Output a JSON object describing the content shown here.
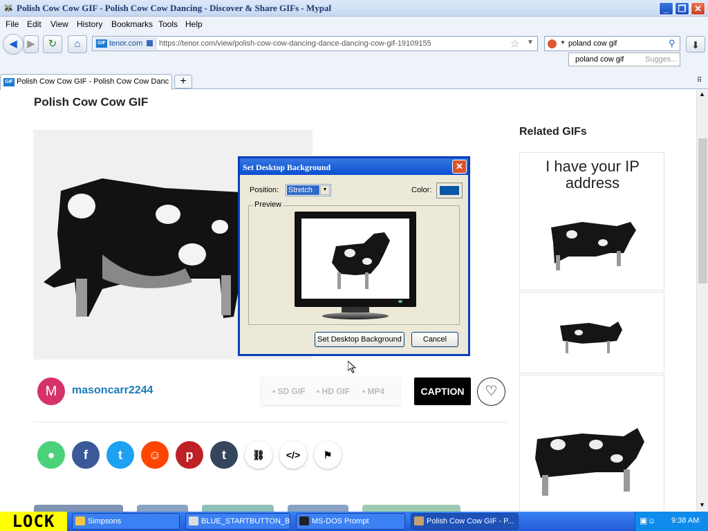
{
  "window": {
    "title": "Polish Cow Cow GIF - Polish Cow Cow Dancing - Discover & Share GIFs - Mypal",
    "minimize": "_",
    "restore": "❐",
    "close": "✕"
  },
  "menu": [
    "File",
    "Edit",
    "View",
    "History",
    "Bookmarks",
    "Tools",
    "Help"
  ],
  "nav": {
    "site_label": "tenor.com",
    "site_icon": "GIF",
    "url": "https://tenor.com/view/polish-cow-cow-dancing-dance-dancing-cow-gif-19109155",
    "search_value": "poland cow gif",
    "suggestion": "poland cow gif",
    "suggestion_hint": "Sugges..."
  },
  "tabs": {
    "active_label": "Polish Cow Cow GIF - Polish Cow Cow Danci...",
    "favicon": "GIF",
    "new_tab": "+"
  },
  "page": {
    "title": "Polish Cow Cow GIF",
    "related_title": "Related GIFs",
    "related_caption": "I have your IP address",
    "user_initial": "M",
    "username": "masoncarr2244",
    "formats": [
      "• SD GIF",
      "• HD GIF",
      "• MP4"
    ],
    "caption_button": "CAPTION",
    "share_colors": [
      "#4bd17a",
      "#3b5998",
      "#1da1f2",
      "#ff4500",
      "#bd2125",
      "#35465c"
    ]
  },
  "dialog": {
    "title": "Set Desktop Background",
    "position_label": "Position:",
    "position_value": "Stretch",
    "color_label": "Color:",
    "color_value": "#0a57a8",
    "preview_label": "Preview",
    "ok_label": "Set Desktop Background",
    "cancel_label": "Cancel"
  },
  "taskbar": {
    "lock_text": "LOCK",
    "items": [
      "Simpsons",
      "BLUE_STARTBUTTON_B...",
      "MS-DOS Prompt",
      "Polish Cow Cow GIF - P..."
    ],
    "clock": "9:38 AM"
  }
}
